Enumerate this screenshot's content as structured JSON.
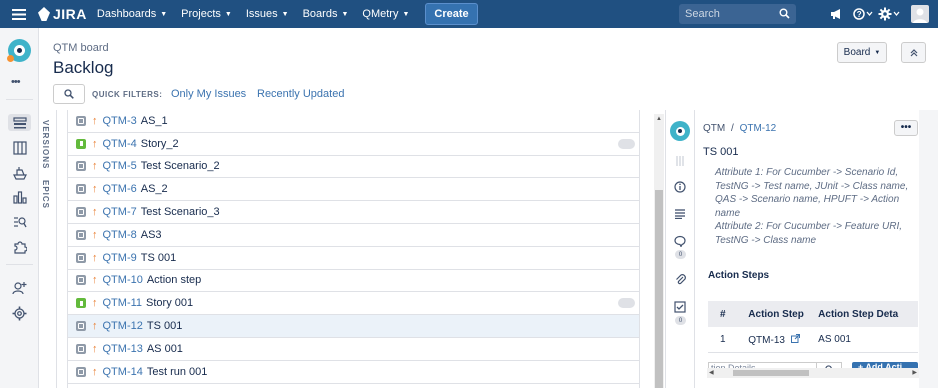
{
  "topnav": {
    "logo": "JIRA",
    "items": [
      {
        "label": "Dashboards"
      },
      {
        "label": "Projects"
      },
      {
        "label": "Issues"
      },
      {
        "label": "Boards"
      },
      {
        "label": "QMetry"
      }
    ],
    "create_label": "Create",
    "search_placeholder": "Search"
  },
  "sidebar": {
    "more": "•••",
    "rail_labels": {
      "versions": "VERSIONS",
      "epics": "EPICS"
    }
  },
  "header": {
    "breadcrumb": "QTM board",
    "title": "Backlog",
    "board_button": "Board",
    "quick_filters_label": "QUICK FILTERS:",
    "filters": [
      "Only My Issues",
      "Recently Updated"
    ]
  },
  "issues": [
    {
      "type": "task",
      "key": "QTM-3",
      "summary": "AS_1",
      "pill": false,
      "selected": false
    },
    {
      "type": "story",
      "key": "QTM-4",
      "summary": "Story_2",
      "pill": true,
      "selected": false
    },
    {
      "type": "task",
      "key": "QTM-5",
      "summary": "Test Scenario_2",
      "pill": false,
      "selected": false
    },
    {
      "type": "task",
      "key": "QTM-6",
      "summary": "AS_2",
      "pill": false,
      "selected": false
    },
    {
      "type": "task",
      "key": "QTM-7",
      "summary": "Test Scenario_3",
      "pill": false,
      "selected": false
    },
    {
      "type": "task",
      "key": "QTM-8",
      "summary": "AS3",
      "pill": false,
      "selected": false
    },
    {
      "type": "task",
      "key": "QTM-9",
      "summary": "TS 001",
      "pill": false,
      "selected": false
    },
    {
      "type": "task",
      "key": "QTM-10",
      "summary": "Action step",
      "pill": false,
      "selected": false
    },
    {
      "type": "story",
      "key": "QTM-11",
      "summary": "Story 001",
      "pill": true,
      "selected": false
    },
    {
      "type": "task",
      "key": "QTM-12",
      "summary": "TS 001",
      "pill": false,
      "selected": true
    },
    {
      "type": "task",
      "key": "QTM-13",
      "summary": "AS 001",
      "pill": false,
      "selected": false
    },
    {
      "type": "task",
      "key": "QTM-14",
      "summary": "Test run 001",
      "pill": false,
      "selected": false
    }
  ],
  "detail": {
    "project": "QTM",
    "separator": "/",
    "issue_key": "QTM-12",
    "more": "•••",
    "close": "×",
    "title": "TS 001",
    "attr1": "Attribute 1:  For Cucumber -> Scenario Id, TestNG -> Test name, JUnit -> Class name, QAS -> Scenario name, HPUFT -> Action name",
    "attr2": "Attribute 2:  For Cucumber -> Feature URI, TestNG -> Class name",
    "comments_count": "0",
    "checklist_count": "0",
    "section_title": "Action Steps",
    "table": {
      "headers": [
        "#",
        "Action Step",
        "Action Step Deta"
      ],
      "rows": [
        {
          "num": "1",
          "step": "QTM-13",
          "detail": "AS 001"
        }
      ]
    },
    "footer_input": "tion Details",
    "add_button": "+ Add Acti"
  },
  "colors": {
    "nav": "#205081",
    "link": "#3b73af",
    "priority": "#e97f33",
    "story": "#63ba3c",
    "task": "#8f9aa8"
  }
}
